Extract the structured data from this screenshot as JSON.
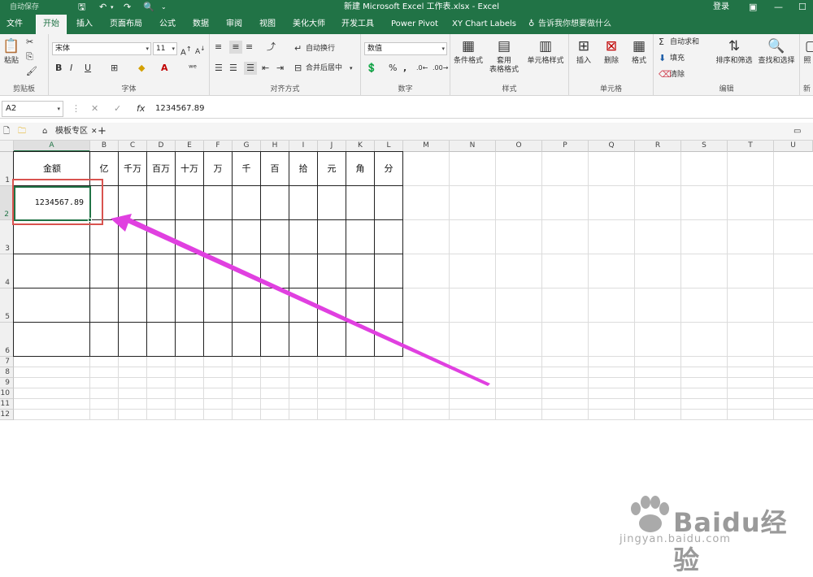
{
  "titlebar": {
    "autosave": "自动保存",
    "title": "新建 Microsoft Excel 工作表.xlsx  -  Excel",
    "login": "登录"
  },
  "tabs": {
    "file": "文件",
    "home": "开始",
    "insert": "插入",
    "layout": "页面布局",
    "formulas": "公式",
    "data": "数据",
    "review": "审阅",
    "view": "视图",
    "meihua": "美化大师",
    "developer": "开发工具",
    "powerpivot": "Power Pivot",
    "xychart": "XY Chart Labels",
    "tellme": "告诉我你想要做什么"
  },
  "ribbon": {
    "paste": "粘贴",
    "clipboard": "剪贴板",
    "font_name": "宋体",
    "font_size": "11",
    "font_group": "字体",
    "bold": "B",
    "italic": "I",
    "underline": "U",
    "wrap": "自动换行",
    "merge": "合并后居中",
    "align_group": "对齐方式",
    "number_format": "数值",
    "percent": "%",
    "comma": ",",
    "number_group": "数字",
    "cond_format": "条件格式",
    "table_format_1": "套用",
    "table_format_2": "表格格式",
    "cell_style": "单元格样式",
    "styles_group": "样式",
    "insert": "插入",
    "delete": "删除",
    "format": "格式",
    "cells_group": "单元格",
    "autosum": "自动求和",
    "fill": "填充",
    "clear": "清除",
    "sort": "排序和筛选",
    "find": "查找和选择",
    "edit_group": "编辑",
    "new_group_1": "照",
    "new_group_2": "新"
  },
  "formula_bar": {
    "name_box": "A2",
    "fx": "fx",
    "value": "1234567.89"
  },
  "sheet_tabs": {
    "template_zone": "模板专区",
    "add": "+"
  },
  "columns": [
    "A",
    "B",
    "C",
    "D",
    "E",
    "F",
    "G",
    "H",
    "I",
    "J",
    "K",
    "L",
    "M",
    "N",
    "O",
    "P",
    "Q",
    "R",
    "S",
    "T",
    "U"
  ],
  "rows": [
    "1",
    "2",
    "3",
    "4",
    "5",
    "6",
    "7",
    "8",
    "9",
    "10",
    "11",
    "12"
  ],
  "cells": {
    "A1": "金额",
    "A2": "1234567.89",
    "headers": [
      "亿",
      "千万",
      "百万",
      "十万",
      "万",
      "千",
      "百",
      "拾",
      "元",
      "角",
      "分"
    ]
  },
  "watermark": {
    "text": "Baidu经验",
    "url": "jingyan.baidu.com"
  },
  "colors": {
    "excel_green": "#217346",
    "annotation_red": "#d9534f",
    "arrow": "#e040e0"
  }
}
